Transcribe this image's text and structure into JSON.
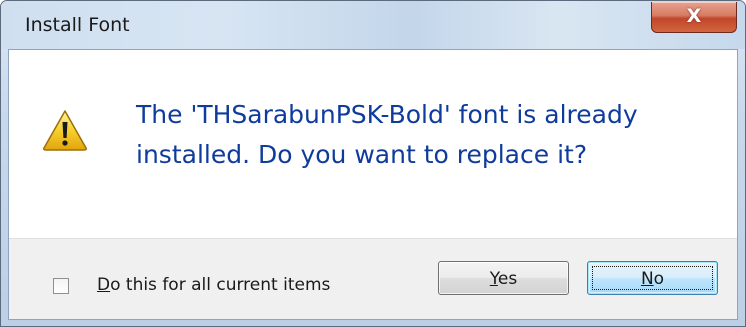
{
  "window": {
    "title": "Install Font",
    "close_label": "X"
  },
  "dialog": {
    "icon": "warning-icon",
    "message": "The 'THSarabunPSK-Bold' font is already installed. Do you want to replace it?"
  },
  "footer": {
    "checkbox_label_mnemonic": "D",
    "checkbox_label_rest": "o this for all current items",
    "checkbox_checked": false,
    "yes_mnemonic": "Y",
    "yes_rest": "es",
    "no_mnemonic": "N",
    "no_rest": "o"
  },
  "colors": {
    "message_text": "#0f3c9c",
    "close_button": "#c2462a",
    "title_bar": "#cfdff0"
  }
}
